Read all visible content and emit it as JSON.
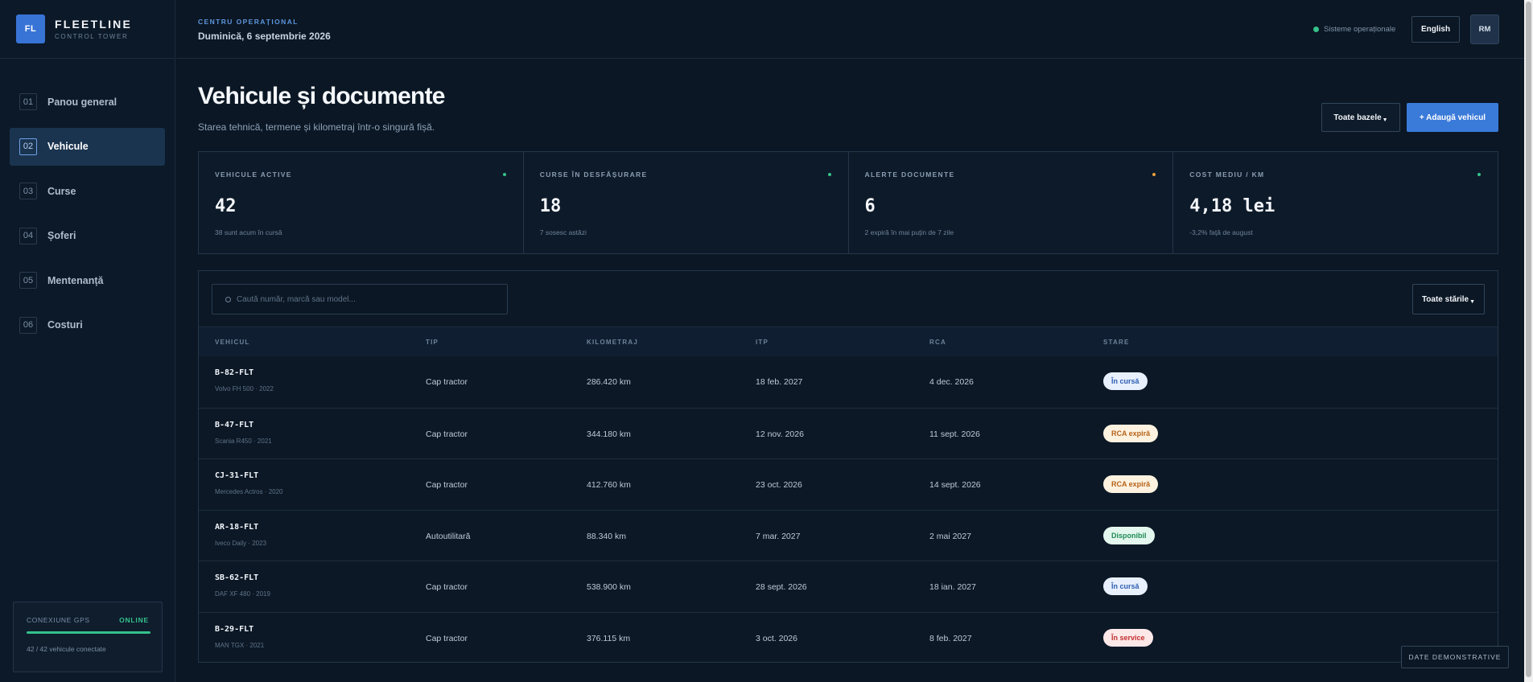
{
  "brand": {
    "logo": "FL",
    "name": "FLEETLINE",
    "subtitle": "CONTROL TOWER"
  },
  "nav": [
    {
      "num": "01",
      "label": "Panou general",
      "active": false
    },
    {
      "num": "02",
      "label": "Vehicule",
      "active": true
    },
    {
      "num": "03",
      "label": "Curse",
      "active": false
    },
    {
      "num": "04",
      "label": "Șoferi",
      "active": false
    },
    {
      "num": "05",
      "label": "Mentenanță",
      "active": false
    },
    {
      "num": "06",
      "label": "Costuri",
      "active": false
    }
  ],
  "gps": {
    "title": "CONEXIUNE GPS",
    "status": "ONLINE",
    "progress": 1.0,
    "count": "42 / 42 vehicule conectate",
    "color": "#35c28b"
  },
  "header": {
    "section": "CENTRU OPERAȚIONAL",
    "date": "Duminică, 6 septembrie 2026",
    "system_status": "Sisteme operaționale",
    "language": "English",
    "user_initials": "RM"
  },
  "page": {
    "title": "Vehicule și documente",
    "subtitle": "Starea tehnică, termene și kilometraj într-o singură fișă.",
    "bases_button": "Toate bazele",
    "add_button": "+ Adaugă vehicul"
  },
  "kpis": [
    {
      "label": "VEHICULE ACTIVE",
      "value": "42",
      "note": "38 sunt acum în cursă",
      "dot_color": "#35c28b"
    },
    {
      "label": "CURSE ÎN DESFĂȘURARE",
      "value": "18",
      "note": "7 sosesc astăzi",
      "dot_color": "#35c28b"
    },
    {
      "label": "ALERTE DOCUMENTE",
      "value": "6",
      "note": "2 expiră în mai puțin de 7 zile",
      "dot_color": "#e8a13a"
    },
    {
      "label": "COST MEDIU / KM",
      "value": "4,18 lei",
      "note": "-3,2% față de august",
      "dot_color": "#35c28b"
    }
  ],
  "table": {
    "search_placeholder": "Caută număr, marcă sau model...",
    "status_filter": "Toate stările",
    "columns": [
      "VEHICUL",
      "TIP",
      "KILOMETRAJ",
      "ITP",
      "RCA",
      "STARE"
    ],
    "rows": [
      {
        "plate": "B-82-FLT",
        "model": "Volvo FH 500 · 2022",
        "type": "Cap tractor",
        "km": "286.420 km",
        "itp": "18 feb. 2027",
        "rca": "4 dec. 2026",
        "status": "În cursă",
        "status_kind": "transit"
      },
      {
        "plate": "B-47-FLT",
        "model": "Scania R450 · 2021",
        "type": "Cap tractor",
        "km": "344.180 km",
        "itp": "12 nov. 2026",
        "rca": "11 sept. 2026",
        "status": "RCA expiră",
        "status_kind": "warning"
      },
      {
        "plate": "CJ-31-FLT",
        "model": "Mercedes Actros · 2020",
        "type": "Cap tractor",
        "km": "412.760 km",
        "itp": "23 oct. 2026",
        "rca": "14 sept. 2026",
        "status": "RCA expiră",
        "status_kind": "warning"
      },
      {
        "plate": "AR-18-FLT",
        "model": "Iveco Daily · 2023",
        "type": "Autoutilitară",
        "km": "88.340 km",
        "itp": "7 mar. 2027",
        "rca": "2 mai 2027",
        "status": "Disponibil",
        "status_kind": "available"
      },
      {
        "plate": "SB-62-FLT",
        "model": "DAF XF 480 · 2019",
        "type": "Cap tractor",
        "km": "538.900 km",
        "itp": "28 sept. 2026",
        "rca": "18 ian. 2027",
        "status": "În cursă",
        "status_kind": "transit"
      },
      {
        "plate": "B-29-FLT",
        "model": "MAN TGX · 2021",
        "type": "Cap tractor",
        "km": "376.115 km",
        "itp": "3 oct. 2026",
        "rca": "8 feb. 2027",
        "status": "În service",
        "status_kind": "service"
      }
    ]
  },
  "badge_styles": {
    "transit": {
      "bg": "#e8f0fd",
      "fg": "#2f5fb3"
    },
    "warning": {
      "bg": "#fdf2e0",
      "fg": "#b5631a"
    },
    "available": {
      "bg": "#e4f7ee",
      "fg": "#1f8a57"
    },
    "service": {
      "bg": "#fde8e8",
      "fg": "#c23030"
    }
  },
  "demo_tag": "DATE DEMONSTRATIVE"
}
